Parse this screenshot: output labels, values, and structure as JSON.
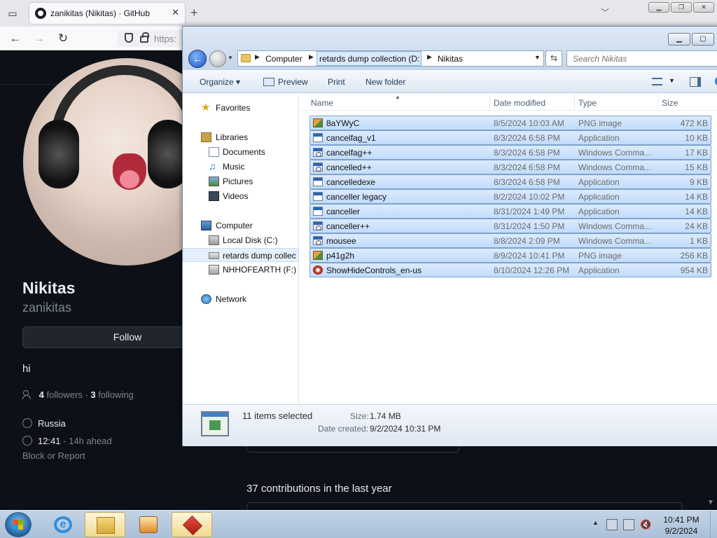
{
  "browser": {
    "tab_title": "zanikitas (Nikitas) · GitHub",
    "tab_close": "✕",
    "new_tab": "+",
    "url_partial": "https:",
    "back": "←",
    "forward": "→",
    "reload": "↻"
  },
  "github": {
    "name": "Nikitas",
    "login": "zanikitas",
    "follow_label": "Follow",
    "bio": "hi",
    "followers_count": "4",
    "followers_label": "followers",
    "following_count": "3",
    "following_label": "following",
    "location": "Russia",
    "local_time": "12:41",
    "time_offset": "- 14h ahead",
    "block_report": "Block or Report",
    "contributions": "37 contributions in the last year"
  },
  "explorer": {
    "address": {
      "crumbs": [
        "Computer",
        "retards dump collection (D:)",
        "Nikitas"
      ]
    },
    "search_placeholder": "Search Nikitas",
    "toolbar": {
      "organize": "Organize",
      "preview": "Preview",
      "print": "Print",
      "new_folder": "New folder"
    },
    "nav": {
      "favorites": "Favorites",
      "libraries": "Libraries",
      "documents": "Documents",
      "music": "Music",
      "pictures": "Pictures",
      "videos": "Videos",
      "computer": "Computer",
      "local_disk": "Local Disk (C:)",
      "dump_drive": "retards dump collec",
      "nhho_drive": "NHHOFEARTH (F:)",
      "network": "Network"
    },
    "columns": {
      "name": "Name",
      "date": "Date modified",
      "type": "Type",
      "size": "Size"
    },
    "files": [
      {
        "name": "8aYWyC",
        "date": "8/5/2024 10:03 AM",
        "type": "PNG image",
        "size": "472 KB",
        "icon": "png"
      },
      {
        "name": "cancelfag_v1",
        "date": "8/3/2024 6:58 PM",
        "type": "Application",
        "size": "10 KB",
        "icon": "app"
      },
      {
        "name": "cancelfag++",
        "date": "8/3/2024 6:58 PM",
        "type": "Windows Comma...",
        "size": "17 KB",
        "icon": "cmd"
      },
      {
        "name": "cancelled++",
        "date": "8/3/2024 6:58 PM",
        "type": "Windows Comma...",
        "size": "15 KB",
        "icon": "cmd"
      },
      {
        "name": "cancelledexe",
        "date": "8/3/2024 6:58 PM",
        "type": "Application",
        "size": "9 KB",
        "icon": "app"
      },
      {
        "name": "canceller legacy",
        "date": "8/2/2024 10:02 PM",
        "type": "Application",
        "size": "14 KB",
        "icon": "app"
      },
      {
        "name": "canceller",
        "date": "8/31/2024 1:49 PM",
        "type": "Application",
        "size": "14 KB",
        "icon": "app"
      },
      {
        "name": "canceller++",
        "date": "8/31/2024 1:50 PM",
        "type": "Windows Comma...",
        "size": "24 KB",
        "icon": "cmd"
      },
      {
        "name": "mousee",
        "date": "8/8/2024 2:09 PM",
        "type": "Windows Comma...",
        "size": "1 KB",
        "icon": "cmd"
      },
      {
        "name": "p41g2h",
        "date": "8/9/2024 10:41 PM",
        "type": "PNG image",
        "size": "256 KB",
        "icon": "png"
      },
      {
        "name": "ShowHideControls_en-us",
        "date": "8/10/2024 12:26 PM",
        "type": "Application",
        "size": "954 KB",
        "icon": "gear"
      }
    ],
    "details": {
      "selected": "11 items selected",
      "size_label": "Size:",
      "size_value": "1.74 MB",
      "created_label": "Date created:",
      "created_value": "9/2/2024 10:31 PM"
    }
  },
  "taskbar": {
    "time": "10:41 PM",
    "date": "9/2/2024"
  }
}
